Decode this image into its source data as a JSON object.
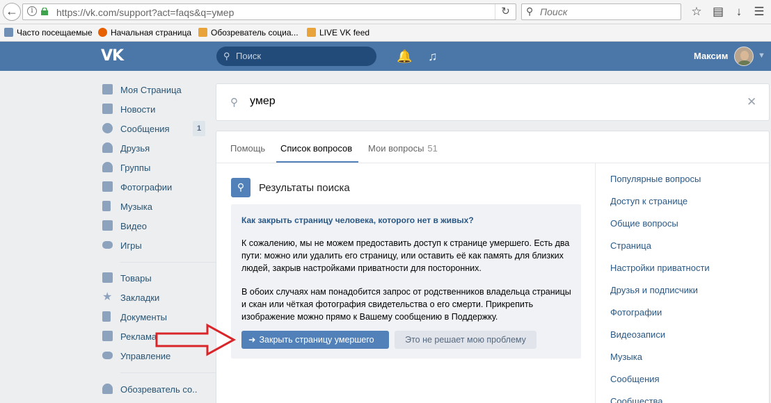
{
  "browser": {
    "url": "https://vk.com/support?act=faqs&q=умер",
    "search_placeholder": "Поиск",
    "bookmarks": [
      "Часто посещаемые",
      "Начальная страница",
      "Обозреватель социа...",
      "LIVE VK feed"
    ]
  },
  "header": {
    "search_placeholder": "Поиск",
    "user_name": "Максим"
  },
  "left_nav": {
    "items": [
      {
        "label": "Моя Страница",
        "icon": "home-icon"
      },
      {
        "label": "Новости",
        "icon": "news-icon"
      },
      {
        "label": "Сообщения",
        "icon": "messages-icon",
        "count": "1"
      },
      {
        "label": "Друзья",
        "icon": "friends-icon"
      },
      {
        "label": "Группы",
        "icon": "groups-icon"
      },
      {
        "label": "Фотографии",
        "icon": "photos-icon"
      },
      {
        "label": "Музыка",
        "icon": "music-icon"
      },
      {
        "label": "Видео",
        "icon": "video-icon"
      },
      {
        "label": "Игры",
        "icon": "games-icon"
      },
      {
        "label": "Товары",
        "icon": "market-icon"
      },
      {
        "label": "Закладки",
        "icon": "bookmarks-icon"
      },
      {
        "label": "Документы",
        "icon": "documents-icon"
      },
      {
        "label": "Реклама",
        "icon": "ads-icon"
      },
      {
        "label": "Управление",
        "icon": "manage-icon"
      },
      {
        "label": "Обозреватель со..",
        "icon": "app-icon"
      }
    ]
  },
  "faq_search": {
    "value": "умер"
  },
  "tabs": [
    {
      "label": "Помощь"
    },
    {
      "label": "Список вопросов"
    },
    {
      "label": "Мои вопросы",
      "count": "51"
    }
  ],
  "results": {
    "title": "Результаты поиска",
    "question": "Как закрыть страницу человека, которого нет в живых?",
    "paragraph1": "К сожалению, мы не можем предоставить доступ к странице умершего. Есть два пути: можно или удалить его страницу, или оставить её как память для близких людей, закрыв настройками приватности для посторонних.",
    "paragraph2": "В обоих случаях нам понадобится запрос от родственников владельца страницы и скан или чёткая фотография свидетельства о его смерти. Прикрепить изображение можно прямо к Вашему сообщению в Поддержку.",
    "primary_button": "Закрыть страницу умершего",
    "secondary_button": "Это не решает мою проблему"
  },
  "sidebar": {
    "items": [
      "Популярные вопросы",
      "Доступ к странице",
      "Общие вопросы",
      "Страница",
      "Настройки приватности",
      "Друзья и подписчики",
      "Фотографии",
      "Видеозаписи",
      "Музыка",
      "Сообщения",
      "Сообщества"
    ]
  },
  "colors": {
    "vk_blue": "#4a76a8",
    "button_blue": "#5181b8",
    "link": "#2a5885",
    "annotation_arrow": "#d9262a"
  }
}
